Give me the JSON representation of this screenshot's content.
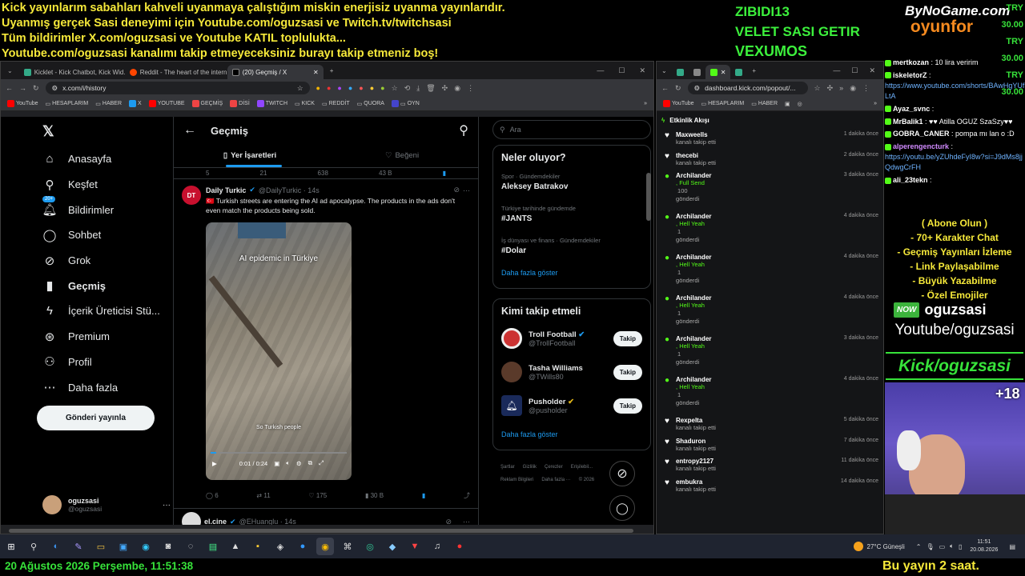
{
  "overlay": {
    "banner_lines": [
      "Kick yayınlarım sabahları kahveli uyanmaya çalıştığım miskin enerjisiz uyanma yayınlarıdır.",
      "Uyanmış gerçek Sasi deneyimi için Youtube.com/oguzsasi ve Twitch.tv/twitchsasi",
      "Tüm bildirimler X.com/oguzsasi ve Youtube KATIL toplulukta...",
      "Youtube.com/oguzsasi kanalımı takip etmeyeceksiniz burayı takip etmeniz boş!"
    ],
    "tags": [
      "ZIBIDI13",
      "VELET SASI GETIR",
      "VEXUMOS"
    ],
    "logo_top": "ByNoGame.com",
    "logo_bottom": "oyunfor",
    "tries": [
      "TRY 30.00",
      "TRY 30.00",
      "TRY 30.00"
    ],
    "datetime": "20 Ağustos 2026 Perşembe, 11:51:38",
    "bottom_right": "Bu yayın 2 saat.",
    "promo": [
      "( Abone Olun )",
      "- 70+ Karakter Chat",
      "- Geçmiş Yayınları İzleme",
      "- Link Paylaşabilme",
      "- Büyük Yazabilme",
      "- Özel Emojiler"
    ],
    "now_label": "oguzsasi",
    "youtube_label": "Youtube/oguzsasi",
    "kick_label": "Kick/oguzsasi",
    "plus_count": "+18"
  },
  "colors": {
    "banner": "#f6e93a",
    "green": "#37e23a",
    "kick": "#53fc18",
    "x_blue": "#1d9bf0"
  },
  "left_browser": {
    "tabs": [
      "Kicklet - Kick Chatbot, Kick Wid...",
      "Reddit - The heart of the intern...",
      "(20) Geçmiş / X"
    ],
    "url": "x.com/i/history",
    "bookmarks": [
      "YouTube",
      "HESAPLARIM",
      "HABER",
      "X",
      "YOUTUBE",
      "GEÇMİŞ",
      "DİSİ",
      "TWITCH",
      "KICK",
      "REDDİT",
      "QUORA",
      "OYN"
    ]
  },
  "x": {
    "nav": [
      "Anasayfa",
      "Keşfet",
      "Bildirimler",
      "Sohbet",
      "Grok",
      "Geçmiş",
      "İçerik Üreticisi Stü...",
      "Premium",
      "Profil",
      "Daha fazla"
    ],
    "notif_badge": "20+",
    "post_button": "Gönderi yayınla",
    "profile_name": "oguzsasi",
    "profile_handle": "@oguzsasi",
    "header": "Geçmiş",
    "tab_bookmarks": "Yer İşaretleri",
    "tab_likes": "Beğeni",
    "prev_actions": [
      "5",
      "21",
      "638",
      "43 B"
    ],
    "tweet1": {
      "name": "Daily Turkic",
      "handle": "@DailyTurkic · 14s",
      "text": "🇹🇷 Turkish streets are entering the AI ad apocalypse. The products in the ads don't even match the products being sold.",
      "video_caption_top": "AI epidemic in Türkiye",
      "video_caption_bottom": "So Turkish people",
      "video_time": "0:01 / 0:24",
      "actions": [
        "6",
        "11",
        "175",
        "30 B"
      ]
    },
    "tweet2": {
      "name": "el.cine",
      "handle": "@EHuanglu · 14s"
    },
    "search_placeholder": "Ara",
    "trends_title": "Neler oluyor?",
    "trends": [
      {
        "meta": "Spor · Gündemdekiler",
        "name": "Aleksey Batrakov"
      },
      {
        "meta": "Türkiye tarihinde gündemde",
        "name": "#JANTS"
      },
      {
        "meta": "İş dünyası ve finans · Gündemdekiler",
        "name": "#Dolar"
      }
    ],
    "show_more": "Daha fazla göster",
    "follow_title": "Kimi takip etmeli",
    "follows": [
      {
        "name": "Troll Football",
        "handle": "@TrollFootball",
        "btn": "Takip"
      },
      {
        "name": "Tasha Williams",
        "handle": "@TWills80",
        "btn": "Takip"
      },
      {
        "name": "Pusholder",
        "handle": "@pusholder",
        "btn": "Takip"
      }
    ],
    "show_more2": "Daha fazla göster",
    "footer": [
      "Şartlar",
      "Gizlilik",
      "Çerezler",
      "Erişilebil...",
      "Reklam Bilgileri",
      "Daha fazla ···",
      "© 2026"
    ]
  },
  "right_browser": {
    "url": "dashboard.kick.com/popout/...",
    "bookmarks": [
      "YouTube",
      "HESAPLARIM",
      "HABER"
    ],
    "panel_title": "Etkinlik Akışı",
    "events": [
      {
        "name": "Maxweells",
        "lines": [
          "kanalı takip etti"
        ],
        "time": "1 dakika önce",
        "type": "heart"
      },
      {
        "name": "thecebi",
        "lines": [
          "kanalı takip etti"
        ],
        "time": "2 dakika önce",
        "type": "heart"
      },
      {
        "name": "Archilander",
        "lines": [
          ", Full Send",
          "100",
          "gönderdi"
        ],
        "time": "3 dakika önce",
        "type": "kick"
      },
      {
        "name": "Archilander",
        "lines": [
          ", Hell Yeah",
          "1",
          "gönderdi"
        ],
        "time": "4 dakika önce",
        "type": "kick"
      },
      {
        "name": "Archilander",
        "lines": [
          ", Hell Yeah",
          "1",
          "gönderdi"
        ],
        "time": "4 dakika önce",
        "type": "kick"
      },
      {
        "name": "Archilander",
        "lines": [
          ", Hell Yeah",
          "1",
          "gönderdi"
        ],
        "time": "4 dakika önce",
        "type": "kick"
      },
      {
        "name": "Archilander",
        "lines": [
          ", Hell Yeah",
          "1",
          "gönderdi"
        ],
        "time": "3 dakika önce",
        "type": "kick"
      },
      {
        "name": "Archilander",
        "lines": [
          ", Hell Yeah",
          "1",
          "gönderdi"
        ],
        "time": "4 dakika önce",
        "type": "kick"
      },
      {
        "name": "Rexpelta",
        "lines": [
          "kanalı takip etti"
        ],
        "time": "5 dakika önce",
        "type": "heart"
      },
      {
        "name": "Shaduron",
        "lines": [
          "kanalı takip etti"
        ],
        "time": "7 dakika önce",
        "type": "heart"
      },
      {
        "name": "entropy2127",
        "lines": [
          "kanalı takip etti"
        ],
        "time": "11 dakika önce",
        "type": "heart"
      },
      {
        "name": "embukra",
        "lines": [
          "kanalı takip etti"
        ],
        "time": "14 dakika önce",
        "type": "heart"
      }
    ]
  },
  "chat": [
    {
      "user": "mertkozan",
      "msg": ": 10 lira veririm",
      "color": "#ffffff"
    },
    {
      "user": "iskeletorZ",
      "msg": ":",
      "link": "https://www.youtube.com/shorts/BAwHgYUfLtA",
      "color": "#ffffff"
    },
    {
      "user": "Ayaz_svnc",
      "msg": ":",
      "color": "#ffffff"
    },
    {
      "user": "MrBalik1",
      "msg": ": ♥♥ Atilla OGUZ SzaSzy♥♥",
      "color": "#ffffff"
    },
    {
      "user": "GOBRA_CANER",
      "msg": ": pompa mı lan o :D",
      "color": "#ffffff"
    },
    {
      "user": "alperengencturk",
      "msg": ":",
      "link": "https://youtu.be/yZUhdeFyI8w?si=J9dMs8jjQdwgCrFH",
      "color": "#d18bff"
    },
    {
      "user": "ali_23tekn",
      "msg": ":",
      "color": "#ffffff"
    }
  ],
  "taskbar": {
    "weather": "27°C Güneşli",
    "time": "11:51",
    "date": "20.08.2026"
  }
}
